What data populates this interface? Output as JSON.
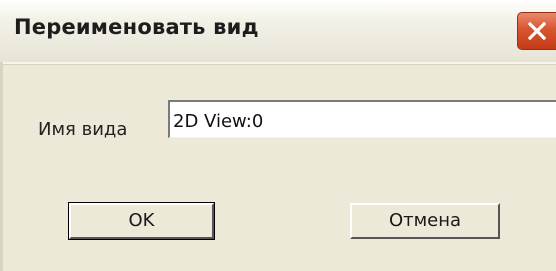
{
  "window": {
    "title": "Переименовать вид",
    "close_icon": "close-icon"
  },
  "form": {
    "name_label": "Имя вида",
    "name_value": "2D View:0"
  },
  "buttons": {
    "ok_label": "OK",
    "cancel_label": "Отмена"
  },
  "colors": {
    "dialog_background": "#ece9d8",
    "close_button": "#d8552f"
  }
}
